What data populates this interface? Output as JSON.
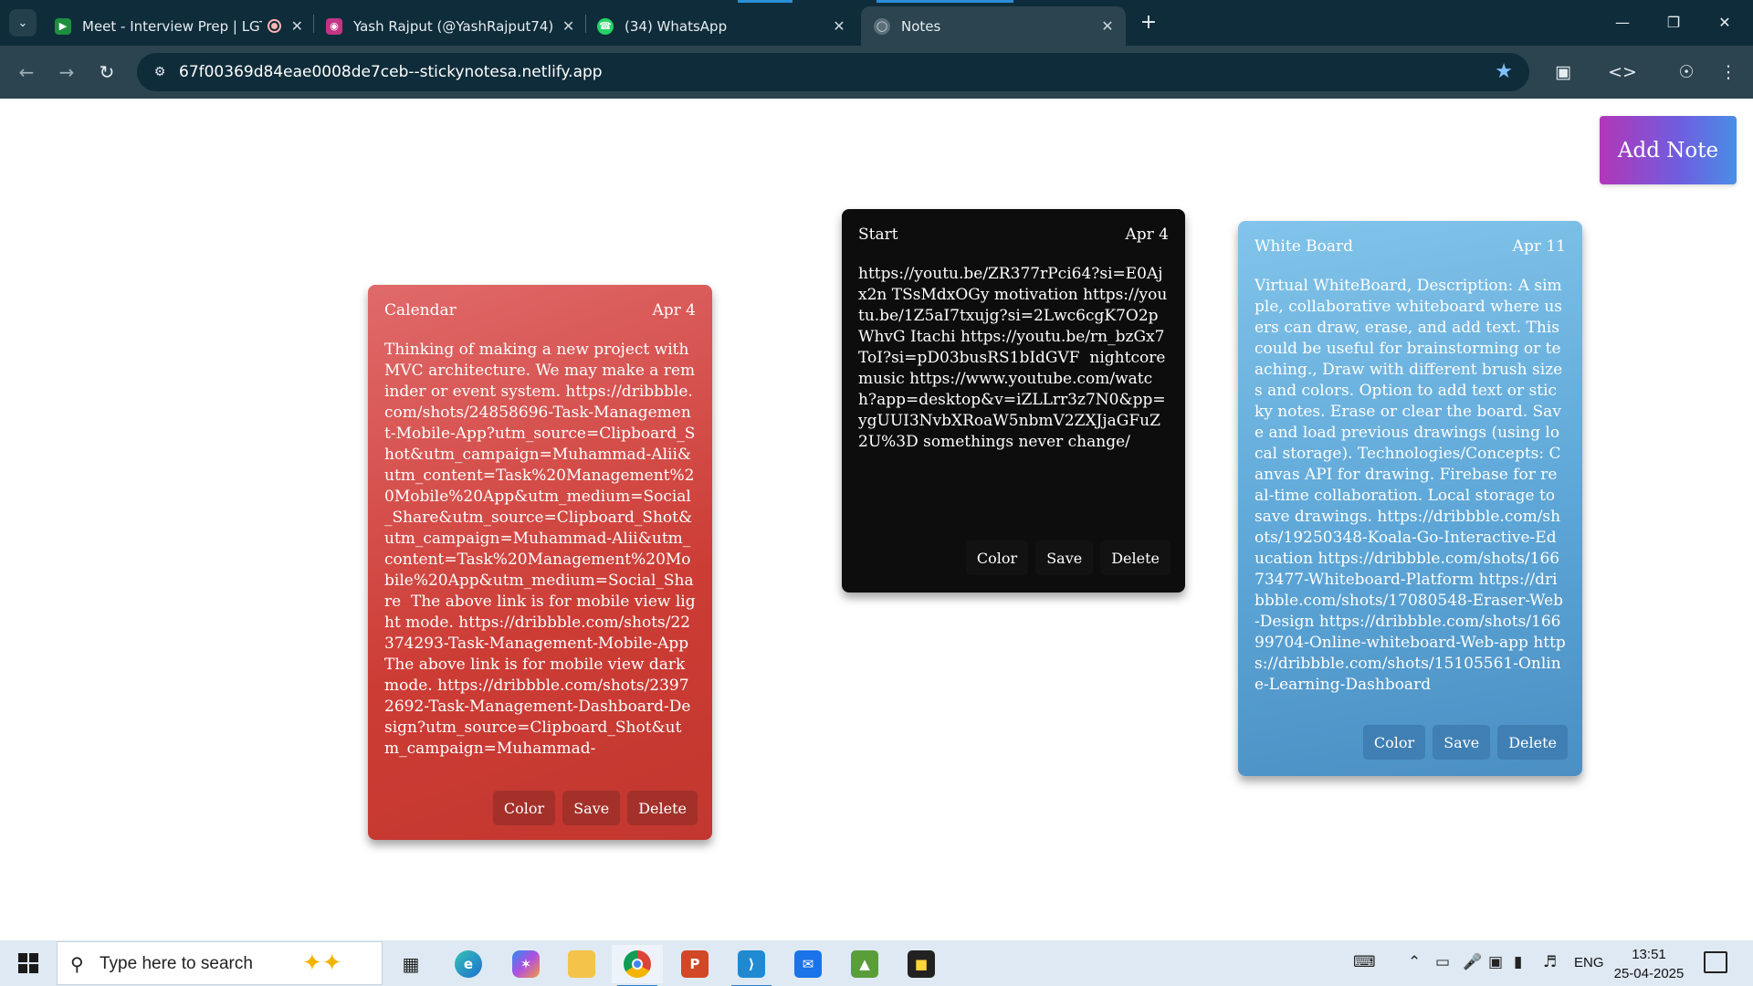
{
  "browser": {
    "tabs": [
      {
        "title": "Meet - Interview Prep | LGT",
        "icon": "google-meet-icon",
        "recording": true
      },
      {
        "title": "Yash Rajput (@YashRajput74) •",
        "icon": "instagram-icon"
      },
      {
        "title": "(34) WhatsApp",
        "icon": "whatsapp-icon"
      },
      {
        "title": "Notes",
        "icon": "globe-icon",
        "active": true
      }
    ],
    "url": "67f00369d84eae0008de7ceb--stickynotesa.netlify.app"
  },
  "page": {
    "add_note_label": "Add Note",
    "notes": [
      {
        "title": "Calendar",
        "date": "Apr 4",
        "color": "#d64a43",
        "body": "Thinking of making a new project with MVC architecture. We may make a reminder or event system. https://dribbble.com/shots/24858696-Task-Management-Mobile-App?utm_source=Clipboard_Shot&utm_campaign=Muhammad-Alii&utm_content=Task%20Management%20Mobile%20App&utm_medium=Social_Share&utm_source=Clipboard_Shot&utm_campaign=Muhammad-Alii&utm_content=Task%20Management%20Mobile%20App&utm_medium=Social_Share  The above link is for mobile view light mode. https://dribbble.com/shots/22374293-Task-Management-Mobile-App  The above link is for mobile view dark mode. https://dribbble.com/shots/23972692-Task-Management-Dashboard-Design?utm_source=Clipboard_Shot&utm_campaign=Muhammad-",
        "buttons": [
          "Color",
          "Save",
          "Delete"
        ]
      },
      {
        "title": "Start",
        "date": "Apr 4",
        "color": "#0d0d0d",
        "body": "https://youtu.be/ZR377rPci64?si=E0Ajx2n TSsMdxOGy motivation https://youtu.be/1Z5aI7txujg?si=2Lwc6cgK7O2pWhvG Itachi https://youtu.be/rn_bzGx7ToI?si=pD03busRS1bIdGVF  nightcore music https://www.youtube.com/watch?app=desktop&v=iZLLrr3z7N0&pp=ygUUI3NvbXRoaW5nbmV2ZXJjaGFuZ2U%3D somethings never change/",
        "buttons": [
          "Color",
          "Save",
          "Delete"
        ]
      },
      {
        "title": "White Board",
        "date": "Apr 11",
        "color": "#5da6d7",
        "body": "Virtual WhiteBoard, Description: A simple, collaborative whiteboard where users can draw, erase, and add text. This could be useful for brainstorming or teaching., Draw with different brush sizes and colors. Option to add text or sticky notes. Erase or clear the board. Save and load previous drawings (using local storage). Technologies/Concepts: Canvas API for drawing. Firebase for real-time collaboration. Local storage to save drawings. https://dribbble.com/shots/19250348-Koala-Go-Interactive-Education https://dribbble.com/shots/16673477-Whiteboard-Platform https://dribbble.com/shots/17080548-Eraser-Web-Design https://dribbble.com/shots/16699704-Online-whiteboard-Web-app https://dribbble.com/shots/15105561-Online-Learning-Dashboard",
        "buttons": [
          "Color",
          "Save",
          "Delete"
        ]
      }
    ]
  },
  "taskbar": {
    "search_placeholder": "Type here to search",
    "apps": [
      "task-view-icon",
      "edge-icon",
      "copilot-icon",
      "file-explorer-icon",
      "chrome-icon",
      "powerpoint-icon",
      "vscode-icon",
      "mail-icon",
      "photos-icon",
      "sticky-notes-icon"
    ],
    "language": "ENG",
    "time": "13:51",
    "date": "25-04-2025"
  }
}
